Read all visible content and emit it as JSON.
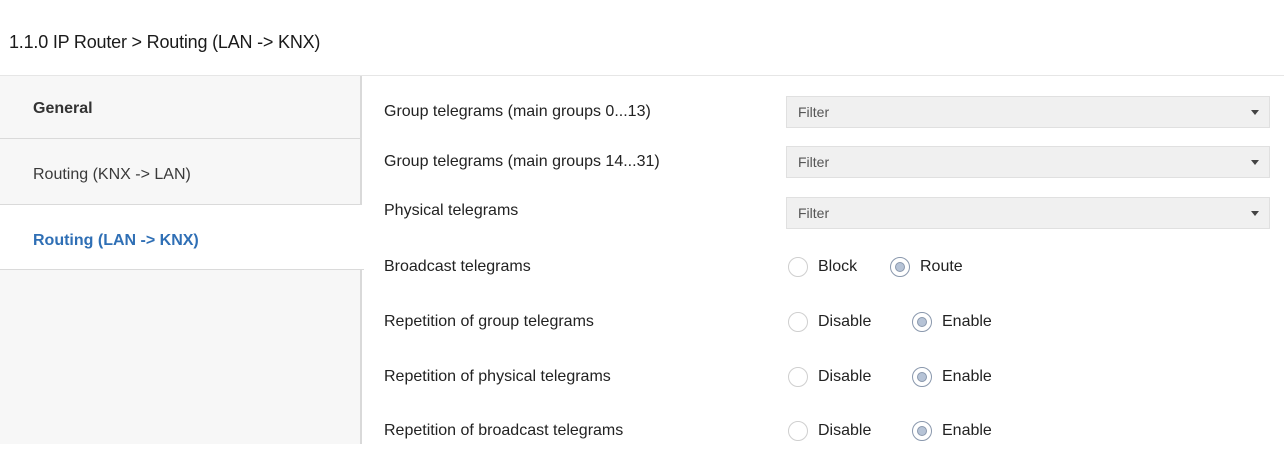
{
  "header": {
    "title": "1.1.0 IP Router > Routing (LAN -> KNX)"
  },
  "sidebar": {
    "items": [
      {
        "label": "General",
        "active": false
      },
      {
        "label": "Routing (KNX -> LAN)",
        "active": false
      },
      {
        "label": "Routing (LAN -> KNX)",
        "active": true
      }
    ]
  },
  "params": {
    "group_main_0_13": {
      "label": "Group telegrams (main groups 0...13)",
      "value": "Filter"
    },
    "group_main_14_31": {
      "label": "Group telegrams (main groups 14...31)",
      "value": "Filter"
    },
    "physical": {
      "label": "Physical telegrams",
      "value": "Filter"
    },
    "broadcast": {
      "label": "Broadcast telegrams",
      "options": [
        "Block",
        "Route"
      ],
      "selected": "Route"
    },
    "rep_group": {
      "label": "Repetition of group telegrams",
      "options": [
        "Disable",
        "Enable"
      ],
      "selected": "Enable"
    },
    "rep_physical": {
      "label": "Repetition of physical telegrams",
      "options": [
        "Disable",
        "Enable"
      ],
      "selected": "Enable"
    },
    "rep_broadcast": {
      "label": "Repetition of broadcast telegrams",
      "options": [
        "Disable",
        "Enable"
      ],
      "selected": "Enable"
    }
  },
  "icons": {
    "dropdown": "caret-down-icon",
    "radio": "radio-button-icon"
  },
  "colors": {
    "active_tab_text": "#2f6fb5",
    "sidebar_bg": "#f7f7f7",
    "dropdown_bg": "#f0f0f0"
  }
}
